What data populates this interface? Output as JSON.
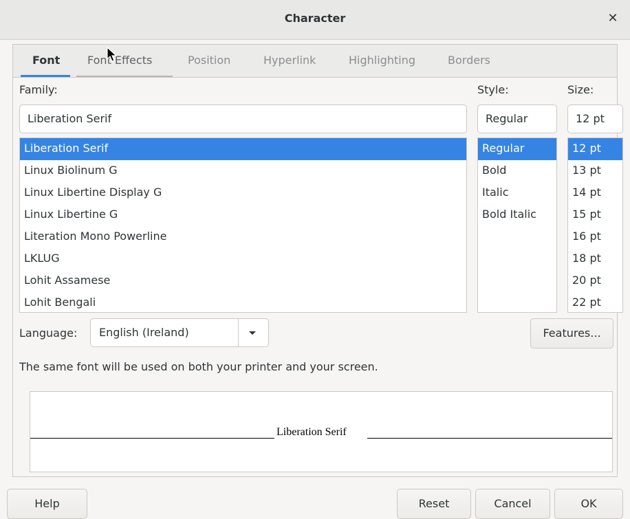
{
  "window": {
    "title": "Character"
  },
  "tabs": [
    {
      "label": "Font"
    },
    {
      "label": "Font Effects"
    },
    {
      "label": "Position"
    },
    {
      "label": "Hyperlink"
    },
    {
      "label": "Highlighting"
    },
    {
      "label": "Borders"
    }
  ],
  "family": {
    "label": "Family:",
    "value": "Liberation Serif",
    "items": [
      "Liberation Serif",
      "Linux Biolinum G",
      "Linux Libertine Display G",
      "Linux Libertine G",
      "Literation Mono Powerline",
      "LKLUG",
      "Lohit Assamese",
      "Lohit Bengali"
    ]
  },
  "style": {
    "label": "Style:",
    "value": "Regular",
    "items": [
      "Regular",
      "Bold",
      "Italic",
      "Bold Italic"
    ]
  },
  "size": {
    "label": "Size:",
    "value": "12 pt",
    "items": [
      "12 pt",
      "13 pt",
      "14 pt",
      "15 pt",
      "16 pt",
      "18 pt",
      "20 pt",
      "22 pt"
    ]
  },
  "language": {
    "label": "Language:",
    "value": "English (Ireland)"
  },
  "features_label": "Features...",
  "info_text": "The same font will be used on both your printer and your screen.",
  "preview_text": "Liberation Serif",
  "buttons": {
    "help": "Help",
    "reset": "Reset",
    "cancel": "Cancel",
    "ok": "OK"
  },
  "colors": {
    "accent": "#3584e4",
    "background": "#f6f5f4"
  }
}
